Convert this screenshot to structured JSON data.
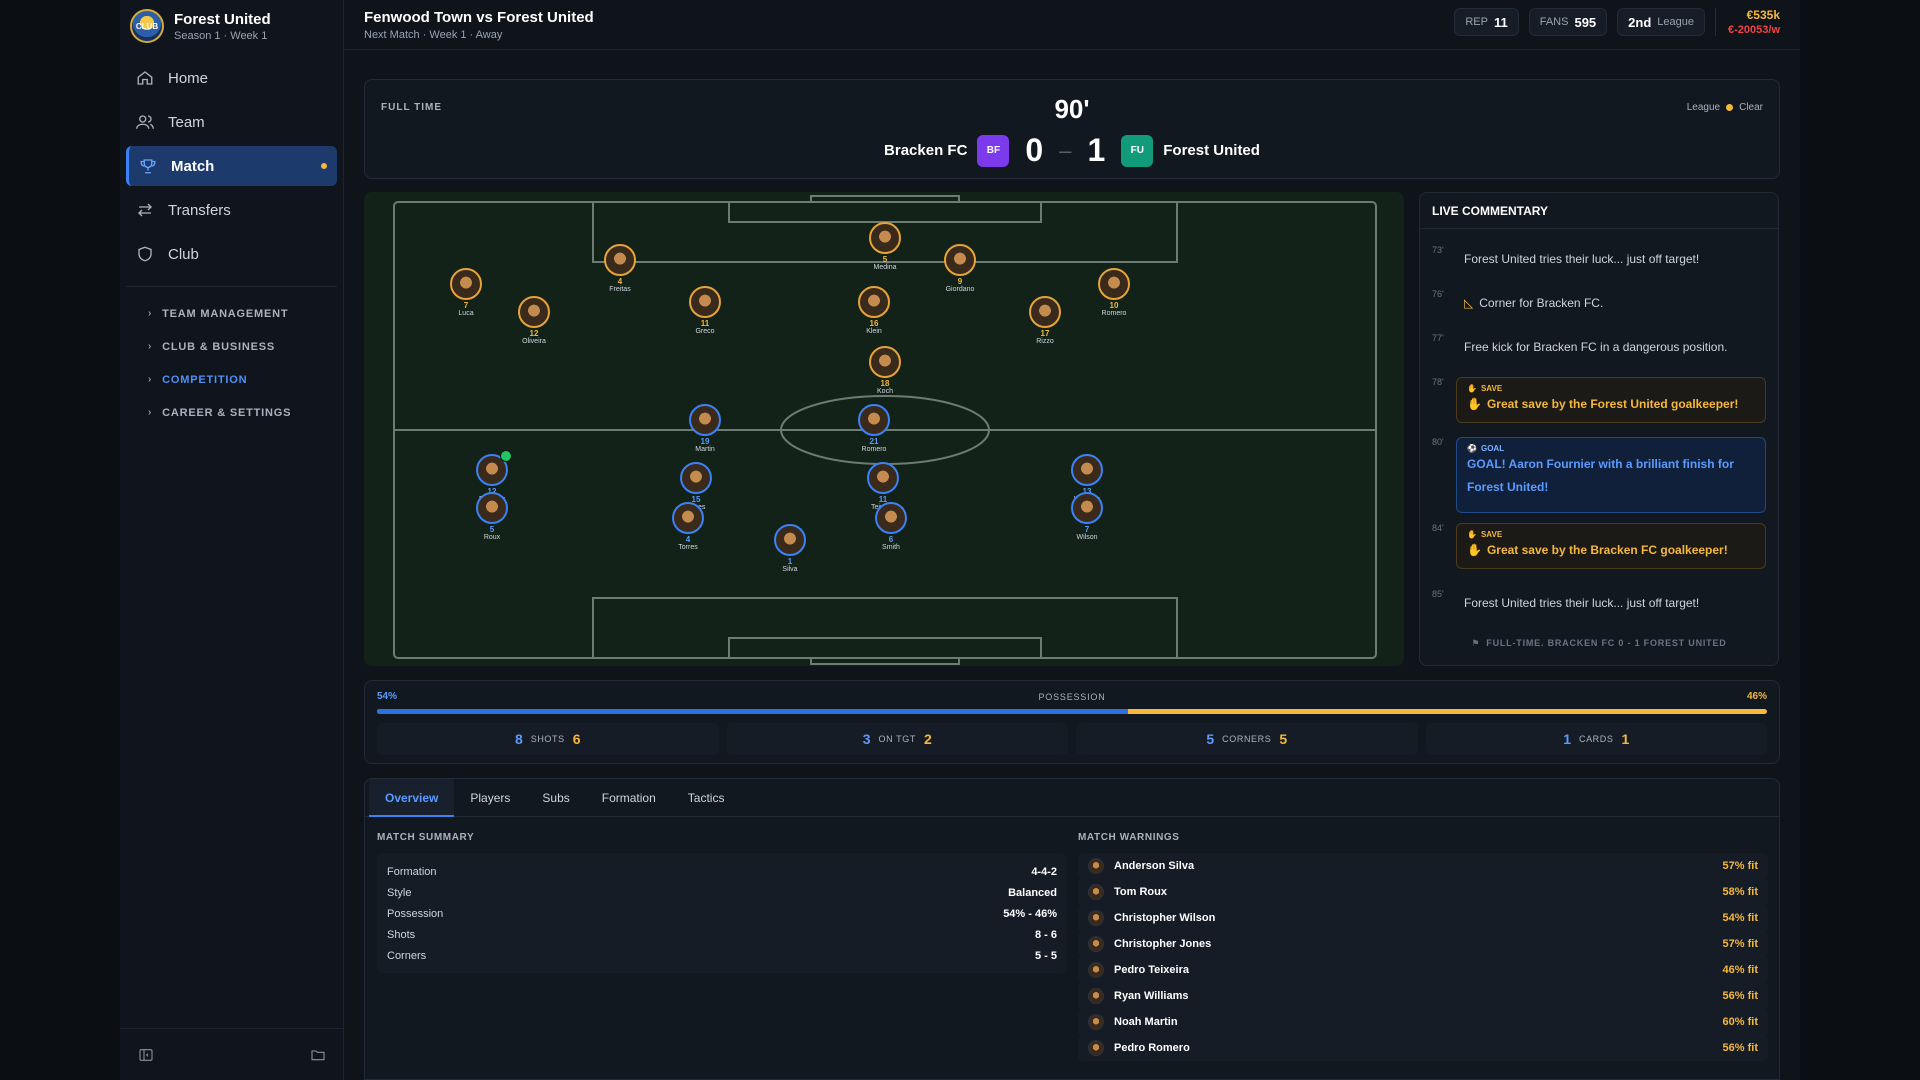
{
  "club": {
    "name": "Forest United",
    "season": "Season 1 · Week 1",
    "logo_text": "CLUB"
  },
  "nav": {
    "items": [
      {
        "label": "Home",
        "icon": "home-icon"
      },
      {
        "label": "Team",
        "icon": "users-icon"
      },
      {
        "label": "Match",
        "icon": "trophy-icon"
      },
      {
        "label": "Transfers",
        "icon": "arrows-icon"
      },
      {
        "label": "Club",
        "icon": "shield-icon"
      }
    ],
    "sections": [
      "TEAM MANAGEMENT",
      "CLUB & BUSINESS",
      "COMPETITION",
      "CAREER & SETTINGS"
    ]
  },
  "topbar": {
    "title": "Fenwood Town vs Forest United",
    "subtitle": "Next Match · Week 1 · Away",
    "rep_label": "REP",
    "rep_value": "11",
    "fans_label": "FANS",
    "fans_value": "595",
    "league_pos": "2nd",
    "league_label": "League",
    "balance": "€535k",
    "weekly": "€-20053/w"
  },
  "match": {
    "status": "FULL TIME",
    "minute": "90'",
    "home_team": "Bracken FC",
    "home_badge": "BF",
    "away_team": "Forest United",
    "away_badge": "FU",
    "home_score": "0",
    "away_score": "1",
    "competition": "League",
    "weather": "Clear"
  },
  "players_home": [
    {
      "num": "5",
      "name": "Medina"
    },
    {
      "num": "4",
      "name": "Freitas"
    },
    {
      "num": "9",
      "name": "Giordano"
    },
    {
      "num": "7",
      "name": "Luca"
    },
    {
      "num": "10",
      "name": "Romero"
    },
    {
      "num": "12",
      "name": "Oliveira"
    },
    {
      "num": "11",
      "name": "Greco"
    },
    {
      "num": "16",
      "name": "Klein"
    },
    {
      "num": "17",
      "name": "Rizzo"
    },
    {
      "num": "18",
      "name": "Koch"
    }
  ],
  "players_away": [
    {
      "num": "19",
      "name": "Martin"
    },
    {
      "num": "21",
      "name": "Romero"
    },
    {
      "num": "12",
      "name": "Fournier"
    },
    {
      "num": "15",
      "name": "Jones"
    },
    {
      "num": "11",
      "name": "Teixeira"
    },
    {
      "num": "13",
      "name": "Williams"
    },
    {
      "num": "5",
      "name": "Roux"
    },
    {
      "num": "4",
      "name": "Torres"
    },
    {
      "num": "6",
      "name": "Smith"
    },
    {
      "num": "7",
      "name": "Wilson"
    },
    {
      "num": "1",
      "name": "Silva"
    }
  ],
  "commentary": {
    "title": "LIVE COMMENTARY",
    "events": [
      {
        "min": "73'",
        "text": "Forest United tries their luck... just off target!"
      },
      {
        "min": "76'",
        "text": "Corner for Bracken FC."
      },
      {
        "min": "77'",
        "text": "Free kick for Bracken FC in a dangerous position."
      },
      {
        "min": "78'",
        "tag": "SAVE",
        "text": "Great save by the Forest United goalkeeper!"
      },
      {
        "min": "80'",
        "tag": "GOAL",
        "text": "GOAL! Aaron Fournier with a brilliant finish for Forest United!"
      },
      {
        "min": "84'",
        "tag": "SAVE",
        "text": "Great save by the Bracken FC goalkeeper!"
      },
      {
        "min": "85'",
        "text": "Forest United tries their luck... just off target!"
      }
    ],
    "footer": "FULL-TIME. BRACKEN FC 0 - 1 FOREST UNITED"
  },
  "possession": {
    "label": "POSSESSION",
    "away_pct": "54%",
    "home_pct": "46%",
    "away_value": 54
  },
  "stats": [
    {
      "away": "8",
      "label": "SHOTS",
      "home": "6"
    },
    {
      "away": "3",
      "label": "ON TGT",
      "home": "2"
    },
    {
      "away": "5",
      "label": "CORNERS",
      "home": "5"
    },
    {
      "away": "1",
      "label": "CARDS",
      "home": "1"
    }
  ],
  "tabs": [
    "Overview",
    "Players",
    "Subs",
    "Formation",
    "Tactics"
  ],
  "summary": {
    "title": "MATCH SUMMARY",
    "rows": [
      {
        "label": "Formation",
        "value": "4-4-2"
      },
      {
        "label": "Style",
        "value": "Balanced"
      },
      {
        "label": "Possession",
        "value": "54% - 46%"
      },
      {
        "label": "Shots",
        "value": "8 - 6"
      },
      {
        "label": "Corners",
        "value": "5 - 5"
      }
    ]
  },
  "warnings": {
    "title": "MATCH WARNINGS",
    "rows": [
      {
        "name": "Anderson Silva",
        "fit": "57% fit"
      },
      {
        "name": "Tom Roux",
        "fit": "58% fit"
      },
      {
        "name": "Christopher Wilson",
        "fit": "54% fit"
      },
      {
        "name": "Christopher Jones",
        "fit": "57% fit"
      },
      {
        "name": "Pedro Teixeira",
        "fit": "46% fit"
      },
      {
        "name": "Ryan Williams",
        "fit": "56% fit"
      },
      {
        "name": "Noah Martin",
        "fit": "60% fit"
      },
      {
        "name": "Pedro Romero",
        "fit": "56% fit"
      }
    ]
  },
  "colors": {
    "accent": "#3b82f6",
    "home": "#f5b83d",
    "away": "#5b9bff"
  }
}
